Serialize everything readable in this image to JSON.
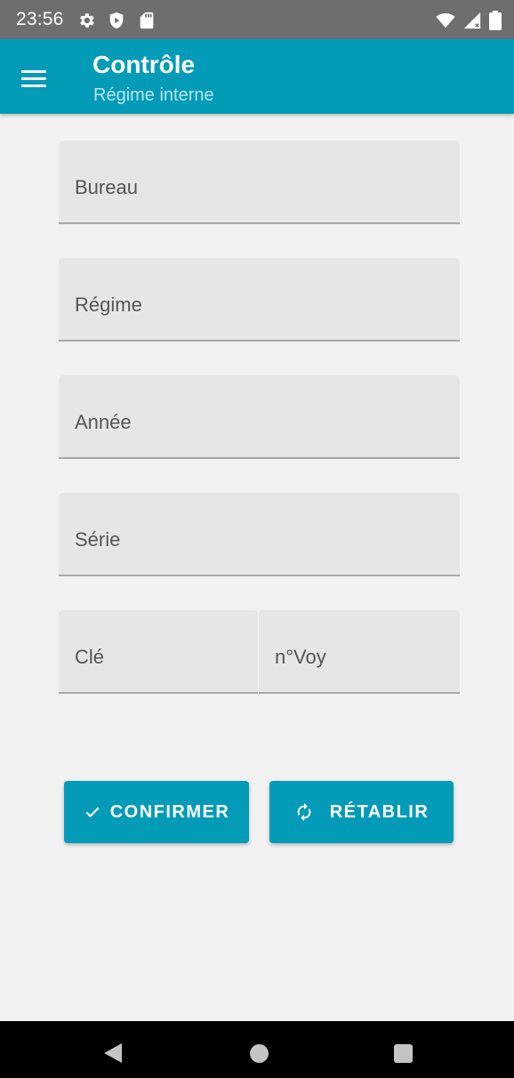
{
  "status_bar": {
    "time": "23:56",
    "icons": [
      "settings-icon",
      "shield-icon",
      "sd-card-icon",
      "wifi-icon",
      "signal-icon",
      "battery-icon"
    ]
  },
  "app_bar": {
    "title": "Contrôle",
    "subtitle": "Régime interne",
    "menu_icon": "hamburger-menu-icon"
  },
  "form": {
    "fields": {
      "bureau": {
        "placeholder": "Bureau",
        "value": ""
      },
      "regime": {
        "placeholder": "Régime",
        "value": ""
      },
      "annee": {
        "placeholder": "Année",
        "value": ""
      },
      "serie": {
        "placeholder": "Série",
        "value": ""
      },
      "cle": {
        "placeholder": "Clé",
        "value": ""
      },
      "nvoy": {
        "placeholder": "n°Voy",
        "value": ""
      }
    }
  },
  "actions": {
    "confirm_label": "CONFIRMER",
    "confirm_icon": "check-icon",
    "reset_label": "RÉTABLIR",
    "reset_icon": "refresh-icon"
  },
  "nav_bar": {
    "icons": [
      "back-icon",
      "home-icon",
      "recents-icon"
    ]
  },
  "colors": {
    "primary": "#039bb7",
    "status_bar": "#6e6e6e",
    "background": "#f2f2f2",
    "field_background": "#e6e6e6"
  }
}
